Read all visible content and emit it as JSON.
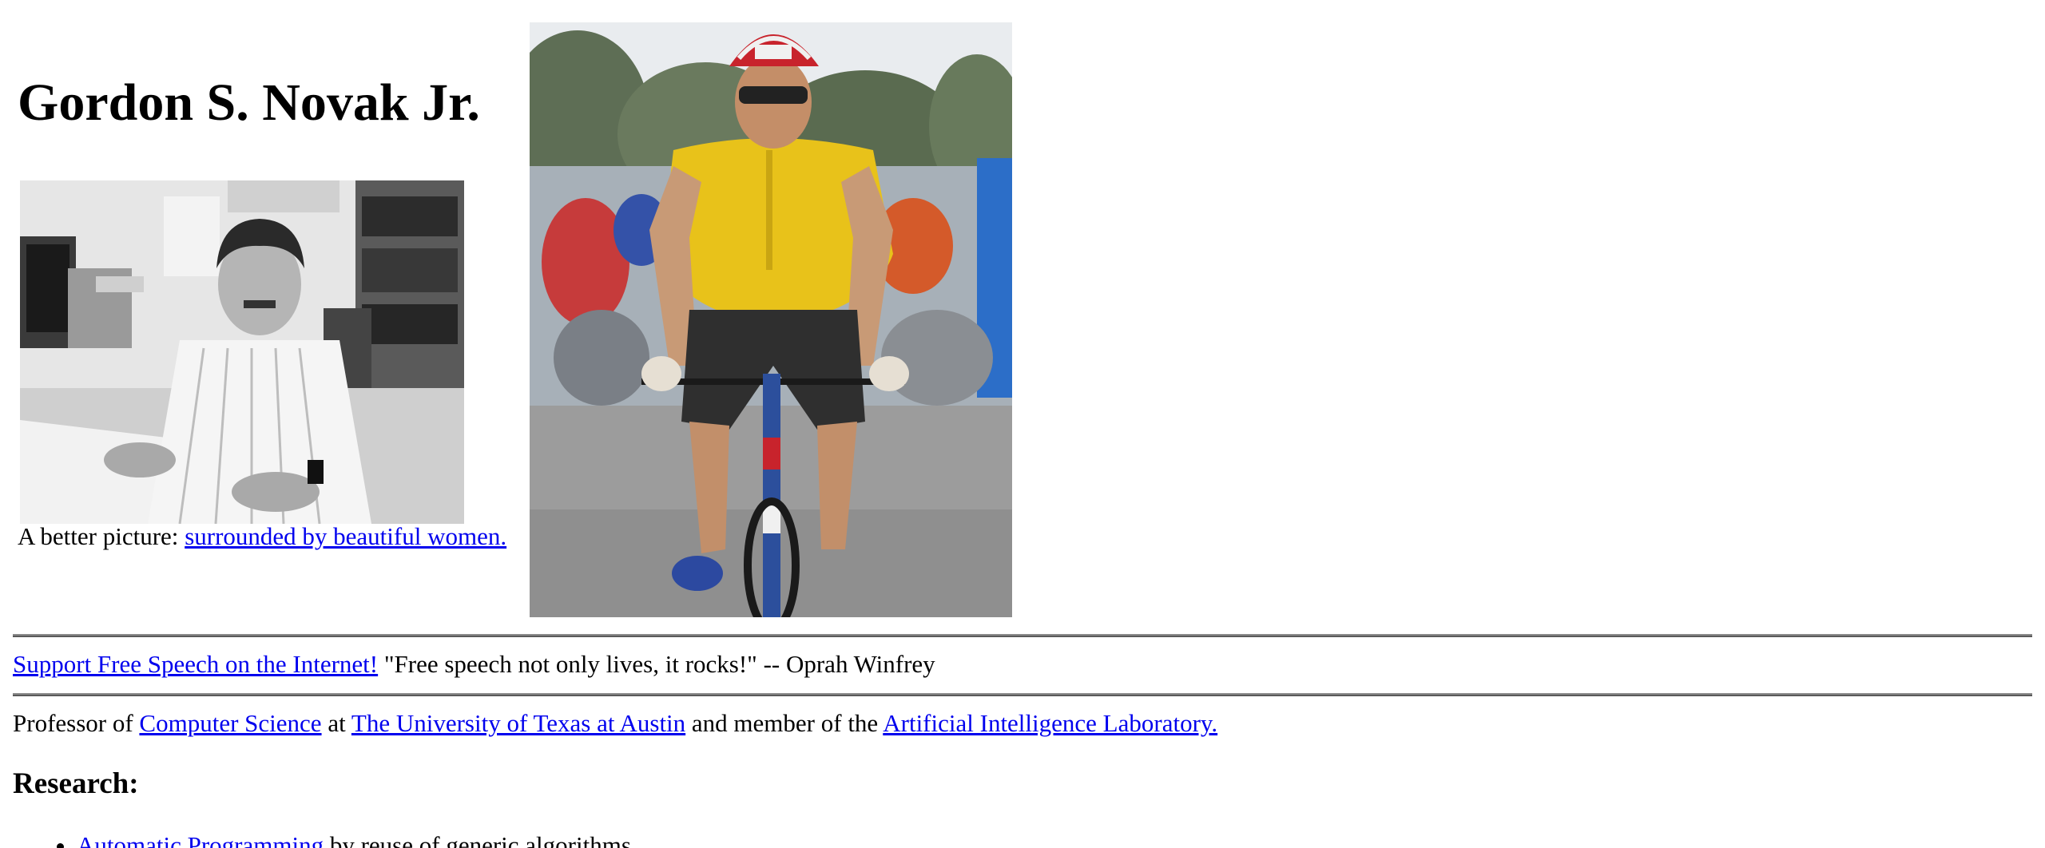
{
  "header": {
    "name": "Gordon S. Novak Jr."
  },
  "photos": {
    "portrait_icon": "portrait-photo",
    "cyclist_icon": "cyclist-photo",
    "caption_prefix": "A better picture:",
    "caption_link": "surrounded by beautiful women."
  },
  "free_speech": {
    "link": "Support Free Speech on the Internet!",
    "quote": "\"Free speech not only lives, it rocks!\" -- Oprah Winfrey"
  },
  "affiliation": {
    "prefix": "Professor of",
    "dept_link": "Computer Science",
    "at": "at",
    "univ_link": "The University of Texas at Austin",
    "member": "and member of the",
    "lab_link": "Artificial Intelligence Laboratory."
  },
  "research": {
    "heading": "Research:",
    "items": [
      {
        "link": "Automatic Programming",
        "text": "by reuse of generic algorithms"
      }
    ]
  },
  "colors": {
    "link": "#0000ee",
    "jersey": "#e8c21a"
  }
}
